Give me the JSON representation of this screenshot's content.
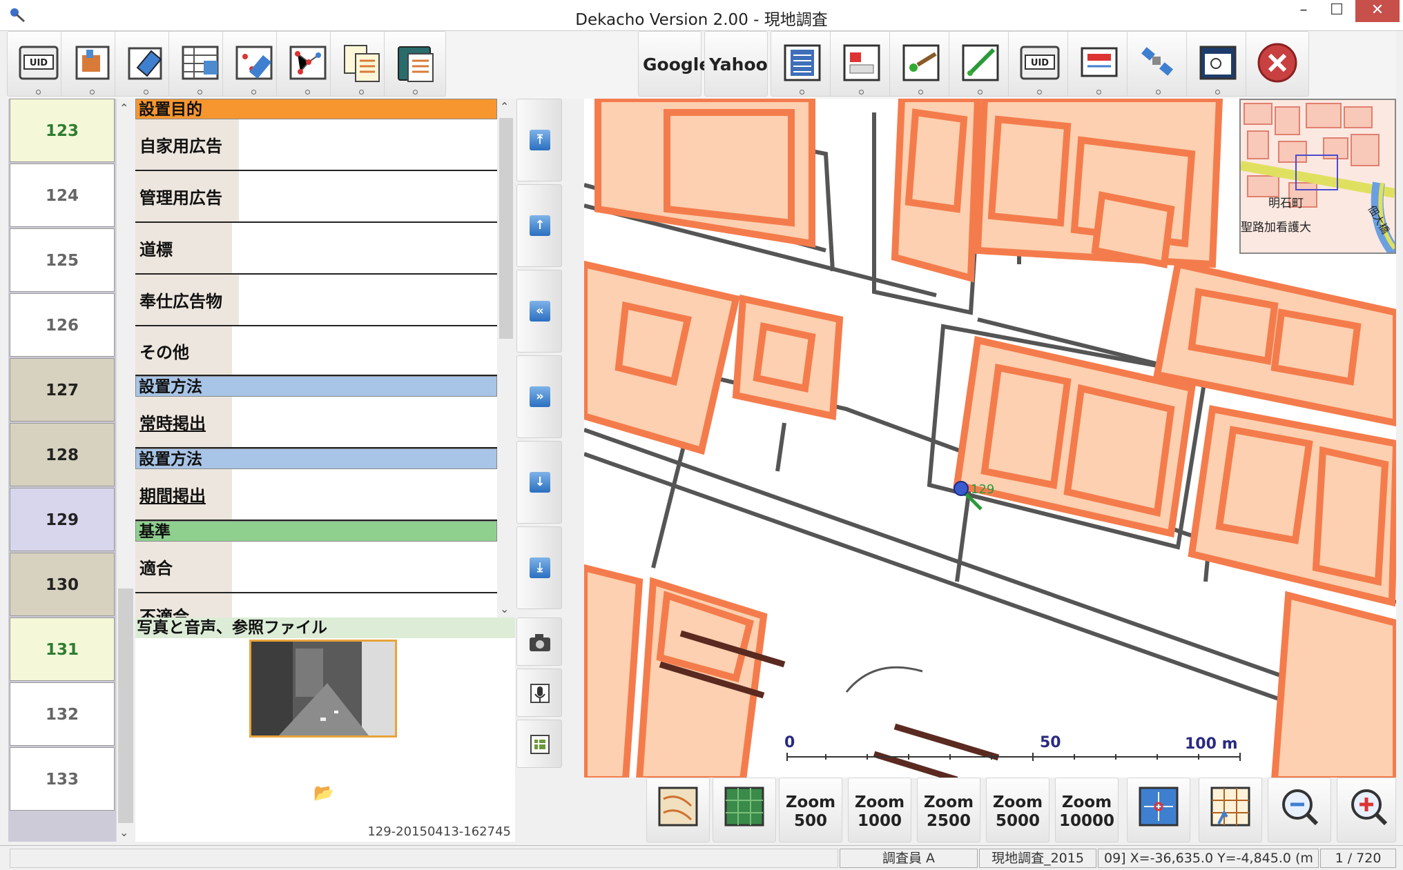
{
  "window": {
    "title": "Dekacho Version 2.00 - 現地調査",
    "minimize": "–",
    "maximize": "☐",
    "close": "✕"
  },
  "toolbar": {
    "google_label": "Google",
    "yahoo_label": "Yahoo"
  },
  "records": [
    {
      "id": "123",
      "color": "#f5f8d8",
      "text_color": "#2e7d32"
    },
    {
      "id": "124",
      "color": "#ffffff",
      "text_color": "#666666"
    },
    {
      "id": "125",
      "color": "#ffffff",
      "text_color": "#666666"
    },
    {
      "id": "126",
      "color": "#ffffff",
      "text_color": "#666666"
    },
    {
      "id": "127",
      "color": "#d6d2bf",
      "text_color": "#222222"
    },
    {
      "id": "128",
      "color": "#d6d2bf",
      "text_color": "#222222"
    },
    {
      "id": "129",
      "color": "#d8d6ec",
      "text_color": "#222222"
    },
    {
      "id": "130",
      "color": "#d6d2bf",
      "text_color": "#222222"
    },
    {
      "id": "131",
      "color": "#f5f8d8",
      "text_color": "#2e7d32"
    },
    {
      "id": "132",
      "color": "#ffffff",
      "text_color": "#666666"
    },
    {
      "id": "133",
      "color": "#ffffff",
      "text_color": "#666666"
    }
  ],
  "form": {
    "section_purpose": "設置目的",
    "purpose_rows": [
      "自家用広告",
      "管理用広告",
      "道標",
      "奉仕広告物",
      "その他"
    ],
    "section_method1": "設置方法",
    "method1_row": "常時掲出",
    "section_method2": "設置方法",
    "method2_row": "期間掲出",
    "section_standard": "基準",
    "standard_rows": [
      "適合",
      "不適合"
    ]
  },
  "photo": {
    "header": "写真と音声、参照ファイル",
    "filename": "129-20150413-162745"
  },
  "map": {
    "marker_label": "129",
    "scale_labels": [
      "0",
      "50",
      "100 m"
    ],
    "minimap_labels": [
      "明石町",
      "聖路加看護大",
      "佃大橋"
    ],
    "building_fill": "#fcd0b0",
    "building_stroke": "#f47c4c",
    "road_color": "#555555"
  },
  "zoom": {
    "z500": [
      "Zoom",
      "500"
    ],
    "z1000": [
      "Zoom",
      "1000"
    ],
    "z2500": [
      "Zoom",
      "2500"
    ],
    "z5000": [
      "Zoom",
      "5000"
    ],
    "z10000": [
      "Zoom",
      "10000"
    ]
  },
  "status": {
    "surveyor": "調査員 A",
    "survey": "現地調査_2015",
    "coords": "09] X=-36,635.0 Y=-4,845.0 (m",
    "page": "1 / 720"
  }
}
